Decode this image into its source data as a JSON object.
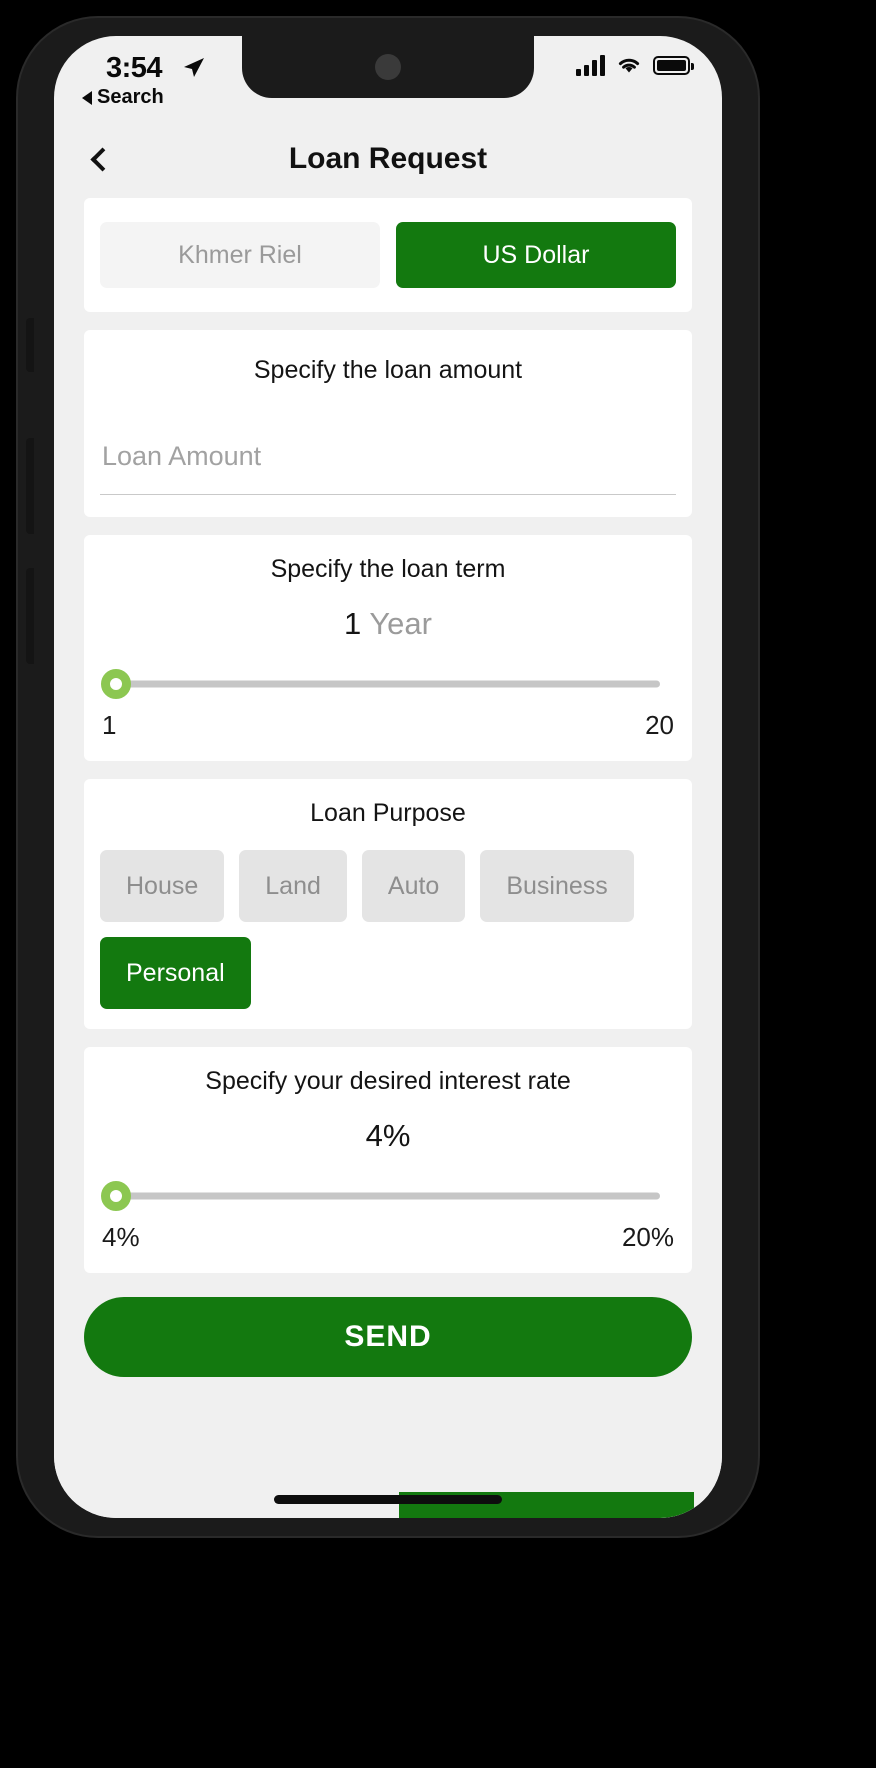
{
  "status_bar": {
    "time": "3:54",
    "location_icon": "location-arrow-icon",
    "back_to_app_label": "Search",
    "signal_icon": "cellular-signal-icon",
    "wifi_icon": "wifi-icon",
    "battery_icon": "battery-full-icon"
  },
  "header": {
    "back_icon": "chevron-left-icon",
    "title": "Loan Request"
  },
  "currency": {
    "options": [
      {
        "label": "Khmer Riel",
        "selected": false
      },
      {
        "label": "US Dollar",
        "selected": true
      }
    ]
  },
  "loan_amount": {
    "title": "Specify the loan amount",
    "placeholder": "Loan Amount",
    "value": ""
  },
  "loan_term": {
    "title": "Specify the loan term",
    "value": "1",
    "unit": "Year",
    "min_label": "1",
    "max_label": "20",
    "min": 1,
    "max": 20,
    "current": 1
  },
  "loan_purpose": {
    "title": "Loan Purpose",
    "options": [
      {
        "label": "House",
        "selected": false
      },
      {
        "label": "Land",
        "selected": false
      },
      {
        "label": "Auto",
        "selected": false
      },
      {
        "label": "Business",
        "selected": false
      },
      {
        "label": "Personal",
        "selected": true
      }
    ]
  },
  "interest_rate": {
    "title": "Specify your desired interest rate",
    "value": "4%",
    "min_label": "4%",
    "max_label": "20%",
    "min": 4,
    "max": 20,
    "current": 4
  },
  "submit": {
    "label": "SEND"
  },
  "colors": {
    "brand_green": "#13790f",
    "slider_green": "#8cc751",
    "screen_bg": "#f0f0f0",
    "card_bg": "#ffffff",
    "chip_off_bg": "#e4e4e4",
    "chip_off_text": "#8e8e8e"
  }
}
